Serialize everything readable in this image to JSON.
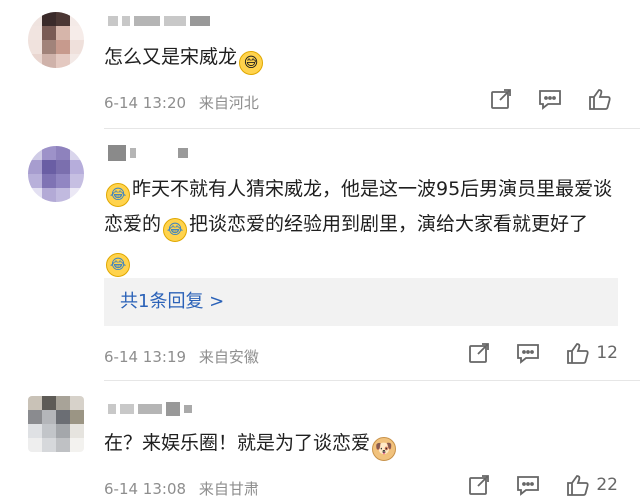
{
  "comments": [
    {
      "text": "怎么又是宋威龙",
      "emoji": "sweat",
      "time": "6-14 13:20",
      "location": "来自河北",
      "like_count": ""
    },
    {
      "text_parts": [
        "昨天不就有人猜宋威龙，他是这一波95后男演员里最爱谈恋爱的",
        "把谈恋爱的经验用到剧里，演给大家看就更好了"
      ],
      "emoji": "laugh",
      "replies": "共1条回复 >",
      "time": "6-14 13:19",
      "location": "来自安徽",
      "like_count": "12"
    },
    {
      "text": "在？来娱乐圈！就是为了谈恋爱",
      "emoji": "doge",
      "time": "6-14 13:08",
      "location": "来自甘肃",
      "like_count": "22"
    }
  ],
  "icons": [
    "share-icon",
    "comment-icon",
    "like-icon"
  ],
  "colors": {
    "link": "#2b62b8",
    "meta": "#8e8e8e",
    "reply_bg": "#f2f2f2"
  }
}
